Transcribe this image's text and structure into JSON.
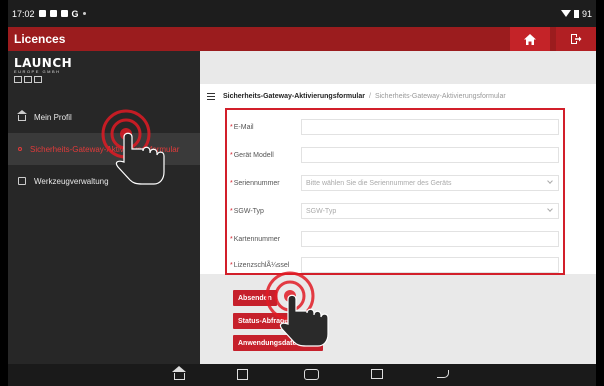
{
  "status_bar": {
    "time": "17:02",
    "battery": "91"
  },
  "app_bar": {
    "title": "Licences",
    "home_icon": "home-icon",
    "exit_icon": "exit-icon",
    "accent_color": "#9b1c1e"
  },
  "sidebar": {
    "logo_name": "LAUNCH",
    "logo_sub": "EUROPE GMBH",
    "items": [
      {
        "label": "Mein Profil",
        "icon": "home-icon",
        "active": false
      },
      {
        "label": "Sicherheits-Gateway-Aktivierungsformular",
        "icon": "key-icon",
        "active": true
      },
      {
        "label": "Werkzeugverwaltung",
        "icon": "tool-icon",
        "active": false
      }
    ]
  },
  "breadcrumb": {
    "current": "Sicherheits-Gateway-Aktivierungsformular",
    "separator": "/",
    "link": "Sicherheits-Gateway-Aktivierungsformular"
  },
  "form": {
    "fields": [
      {
        "label": "E-Mail",
        "value": "",
        "placeholder": "",
        "type": "input"
      },
      {
        "label": "Gerät Modell",
        "value": "",
        "placeholder": "",
        "type": "input"
      },
      {
        "label": "Seriennummer",
        "value": "",
        "placeholder": "Bitte wählen Sie die Seriennummer des Geräts",
        "type": "select"
      },
      {
        "label": "SGW-Typ",
        "value": "",
        "placeholder": "SGW-Typ",
        "type": "select"
      },
      {
        "label": "Kartennummer",
        "value": "",
        "placeholder": "",
        "type": "input"
      },
      {
        "label": "LizenzschlÃ¼ssel",
        "value": "",
        "placeholder": "",
        "type": "input"
      }
    ],
    "required_mark": "*",
    "highlight_color": "#d21f2a"
  },
  "buttons": {
    "submit": "Absenden",
    "status": "Status-Abfrage",
    "records": "Anwendungsdatensätze",
    "button_color": "#c6202b"
  },
  "nav_bar": [
    "home-icon",
    "recent-apps-icon",
    "vci-icon",
    "screenshot-icon",
    "back-icon"
  ]
}
